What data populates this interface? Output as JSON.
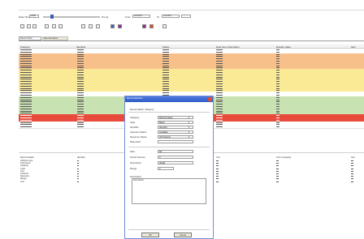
{
  "toolbar": {
    "time_label": "Data Time:",
    "time_value": "2008",
    "slider_min_label": "",
    "slider_max_label": "M Log",
    "from_label": "From",
    "from_value": "1/1/2007",
    "to_label": "To",
    "to_value": "7/1/2007",
    "icons": [
      "magnify-icon",
      "select-icon",
      "pan-icon",
      "zoom-icon",
      "back-icon",
      "forward-icon",
      "refresh-icon",
      "print-icon",
      "layout-icon",
      "grid-icon",
      "chart-icon",
      "map-icon",
      "filter-icon",
      "export-icon"
    ]
  },
  "tabs": [
    "Record View",
    "Records Editor"
  ],
  "grid": {
    "headers": [
      "Category",
      "Identifier",
      "Status",
      "Date time information",
      "Display value",
      "Item"
    ],
    "row_colors": {
      "orange": "#f7c08a",
      "yellow": "#faea96",
      "green": "#c9e2b2",
      "red": "#e84a3c",
      "white": "#ffffff"
    }
  },
  "bottom": {
    "left_title": "Record details",
    "left_items": [
      "Attribute type",
      "Total items",
      "Capacity",
      "Load",
      "Unit",
      "Channel",
      "Resource",
      "Range",
      "Unit"
    ],
    "mid_title": "Identifier",
    "right_title": "Unit of Capacity",
    "far_title": "Item",
    "third_title": "Unit"
  },
  "dialog": {
    "title": "Record Selection",
    "subtitle": "Record Editor Category",
    "fields": [
      {
        "label": "Category",
        "value": "Record values"
      },
      {
        "label": "Style",
        "value": "Blank"
      },
      {
        "label": "Identifier",
        "value": "Identifier"
      },
      {
        "label": "Selection Status",
        "value": "Available"
      },
      {
        "label": "Resource Status",
        "value": "All Products"
      },
      {
        "label": "Date Field",
        "value": ""
      }
    ],
    "lower": [
      {
        "label": "Start",
        "value": "8/1"
      },
      {
        "label": "Period Number",
        "value": "0"
      },
      {
        "label": "Description",
        "value": "[Field]"
      },
      {
        "label": "Range",
        "value": "2"
      }
    ],
    "description_label": "Description",
    "description_value": "Description",
    "ok": "OK",
    "cancel": "Cancel"
  }
}
